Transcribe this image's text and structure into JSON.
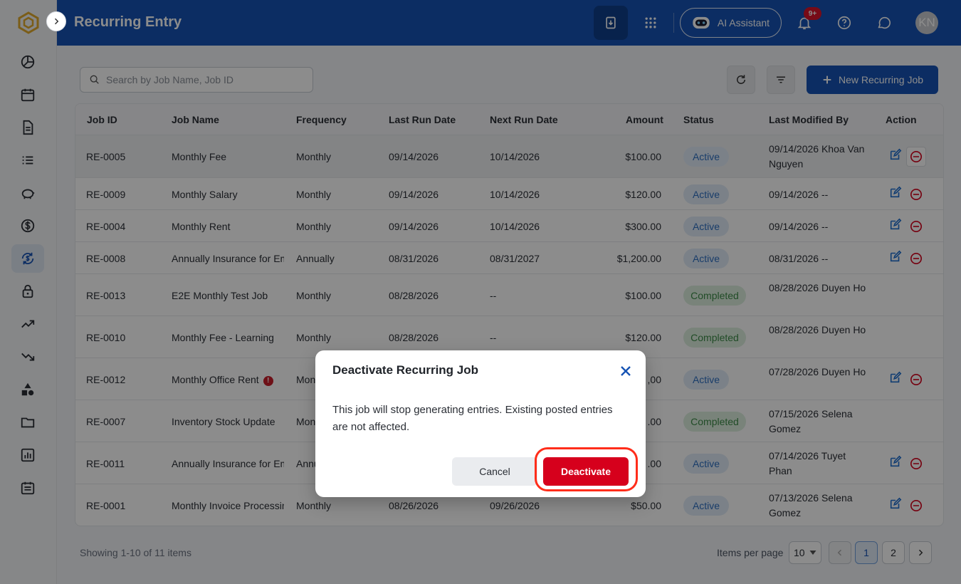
{
  "app": {
    "page_title": "Recurring Entry"
  },
  "header": {
    "ai_assistant_label": "AI Assistant",
    "notification_count": "9+",
    "avatar_initials": "KN"
  },
  "sidebar": {
    "items": [
      {
        "name": "dashboard",
        "icon": "pie-chart-icon"
      },
      {
        "name": "calendar",
        "icon": "calendar-icon"
      },
      {
        "name": "documents",
        "icon": "document-icon"
      },
      {
        "name": "list",
        "icon": "list-icon"
      },
      {
        "name": "savings",
        "icon": "piggy-bank-icon"
      },
      {
        "name": "payments",
        "icon": "dollar-icon"
      },
      {
        "name": "recurring",
        "icon": "recurring-dollar-icon",
        "active": true
      },
      {
        "name": "security",
        "icon": "lock-icon"
      },
      {
        "name": "income",
        "icon": "trend-up-icon"
      },
      {
        "name": "expenses",
        "icon": "trend-down-icon"
      },
      {
        "name": "assets",
        "icon": "shapes-icon"
      },
      {
        "name": "files",
        "icon": "folder-icon"
      },
      {
        "name": "reports",
        "icon": "bar-chart-icon"
      },
      {
        "name": "schedule",
        "icon": "calendar-list-icon"
      }
    ]
  },
  "toolbar": {
    "search_placeholder": "Search by Job Name, Job ID",
    "new_button_label": "New Recurring Job"
  },
  "table": {
    "columns": [
      "Job ID",
      "Job Name",
      "Frequency",
      "Last Run Date",
      "Next Run Date",
      "Amount",
      "Status",
      "Last Modified By",
      "Action"
    ],
    "rows": [
      {
        "id": "RE-0005",
        "name": "Monthly Fee",
        "frequency": "Monthly",
        "last_run": "09/14/2026",
        "next_run": "10/14/2026",
        "amount": "$100.00",
        "status": "Active",
        "modified": "09/14/2026 Khoa Van Nguyen"
      },
      {
        "id": "RE-0009",
        "name": "Monthly Salary",
        "frequency": "Monthly",
        "last_run": "09/14/2026",
        "next_run": "10/14/2026",
        "amount": "$120.00",
        "status": "Active",
        "modified": "09/14/2026 --"
      },
      {
        "id": "RE-0004",
        "name": "Monthly Rent",
        "frequency": "Monthly",
        "last_run": "09/14/2026",
        "next_run": "10/14/2026",
        "amount": "$300.00",
        "status": "Active",
        "modified": "09/14/2026 --"
      },
      {
        "id": "RE-0008",
        "name": "Annually Insurance for Em",
        "frequency": "Annually",
        "last_run": "08/31/2026",
        "next_run": "08/31/2027",
        "amount": "$1,200.00",
        "status": "Active",
        "modified": "08/31/2026 --"
      },
      {
        "id": "RE-0013",
        "name": "E2E Monthly Test Job",
        "frequency": "Monthly",
        "last_run": "08/28/2026",
        "next_run": "--",
        "amount": "$100.00",
        "status": "Completed",
        "modified": "08/28/2026 Duyen Ho"
      },
      {
        "id": "RE-0010",
        "name": "Monthly Fee - Learning",
        "frequency": "Monthly",
        "last_run": "08/28/2026",
        "next_run": "--",
        "amount": "$120.00",
        "status": "Completed",
        "modified": "08/28/2026 Duyen Ho"
      },
      {
        "id": "RE-0012",
        "name": "Monthly Office Rent",
        "frequency": "Mon",
        "last_run": "",
        "next_run": "",
        "amount": ",00",
        "status": "Active",
        "modified": "07/28/2026 Duyen Ho"
      },
      {
        "id": "RE-0007",
        "name": "Inventory Stock Update",
        "frequency": "Mon",
        "last_run": "",
        "next_run": "",
        "amount": ".00",
        "status": "Completed",
        "modified": "07/15/2026 Selena Gomez"
      },
      {
        "id": "RE-0011",
        "name": "Annually Insurance for Em",
        "frequency": "Annu",
        "last_run": "",
        "next_run": "",
        "amount": ".00",
        "status": "Active",
        "modified": "07/14/2026 Tuyet Phan"
      },
      {
        "id": "RE-0001",
        "name": "Monthly Invoice Processin",
        "frequency": "Monthly",
        "last_run": "08/26/2026",
        "next_run": "09/26/2026",
        "amount": "$50.00",
        "status": "Active",
        "modified": "07/13/2026 Selena Gomez"
      }
    ]
  },
  "pagination": {
    "summary": "Showing 1-10 of 11 items",
    "items_per_page_label": "Items per page",
    "items_per_page_value": "10",
    "pages": [
      "1",
      "2"
    ],
    "current_page": "1"
  },
  "modal": {
    "title": "Deactivate Recurring Job",
    "body": "This job will stop generating entries. Existing posted entries are not affected.",
    "cancel_label": "Cancel",
    "confirm_label": "Deactivate"
  },
  "colors": {
    "header_bg": "#1653b4",
    "active_status": "#2f6fc1",
    "completed_status": "#3d8a48",
    "danger": "#d6001c",
    "highlight": "#ff2d1a"
  }
}
